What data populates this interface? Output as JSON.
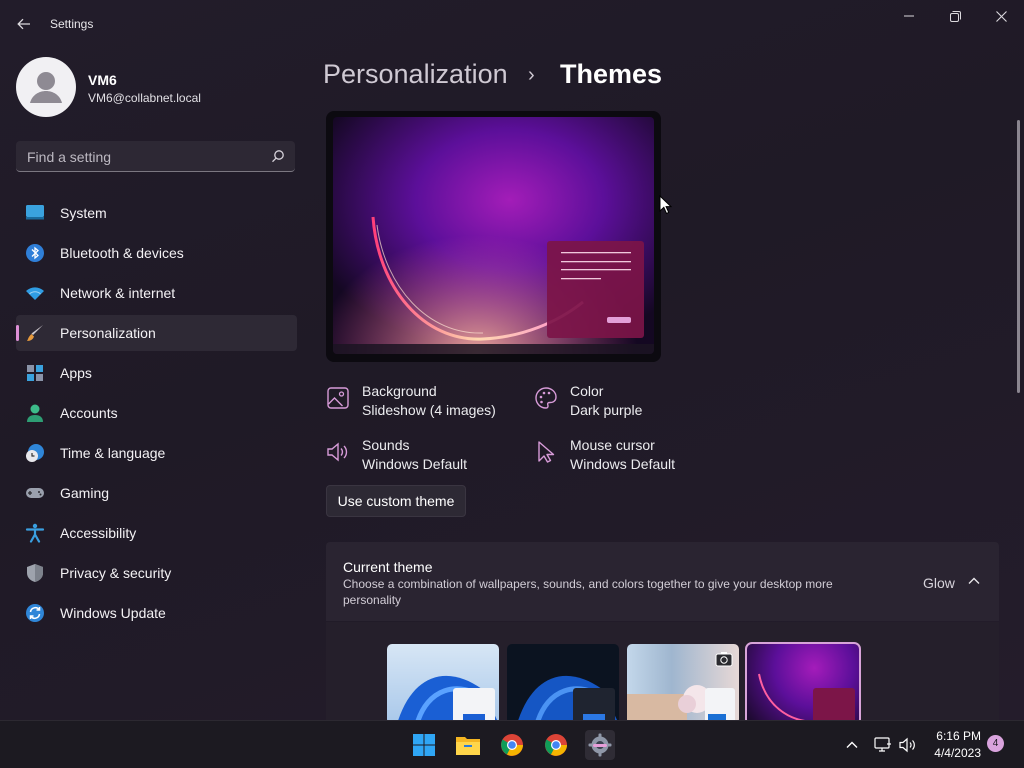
{
  "window": {
    "title": "Settings"
  },
  "user": {
    "name": "VM6",
    "email": "VM6@collabnet.local"
  },
  "search": {
    "placeholder": "Find a setting"
  },
  "nav": {
    "items": [
      {
        "label": "System",
        "icon": "system-icon"
      },
      {
        "label": "Bluetooth & devices",
        "icon": "bluetooth-icon"
      },
      {
        "label": "Network & internet",
        "icon": "wifi-icon"
      },
      {
        "label": "Personalization",
        "icon": "brush-icon",
        "selected": true
      },
      {
        "label": "Apps",
        "icon": "apps-icon"
      },
      {
        "label": "Accounts",
        "icon": "person-icon"
      },
      {
        "label": "Time & language",
        "icon": "clock-globe-icon"
      },
      {
        "label": "Gaming",
        "icon": "gamepad-icon"
      },
      {
        "label": "Accessibility",
        "icon": "accessibility-icon"
      },
      {
        "label": "Privacy & security",
        "icon": "shield-icon"
      },
      {
        "label": "Windows Update",
        "icon": "update-icon"
      }
    ]
  },
  "breadcrumb": {
    "parent": "Personalization",
    "separator": "›",
    "current": "Themes"
  },
  "theme_props": {
    "background": {
      "label": "Background",
      "value": "Slideshow (4 images)"
    },
    "color": {
      "label": "Color",
      "value": "Dark purple"
    },
    "sounds": {
      "label": "Sounds",
      "value": "Windows Default"
    },
    "cursor": {
      "label": "Mouse cursor",
      "value": "Windows Default"
    }
  },
  "custom_theme_button": "Use custom theme",
  "current_theme": {
    "title": "Current theme",
    "description": "Choose a combination of wallpapers, sounds, and colors together to give your desktop more personality",
    "value": "Glow"
  },
  "taskbar": {
    "apps": [
      "start-icon",
      "file-explorer-icon",
      "chrome-icon",
      "chrome-icon",
      "settings-icon"
    ],
    "time": "6:16 PM",
    "date": "4/4/2023",
    "notifications": "4"
  },
  "colors": {
    "accent": "#dd8fd6",
    "background": "#201b27"
  }
}
